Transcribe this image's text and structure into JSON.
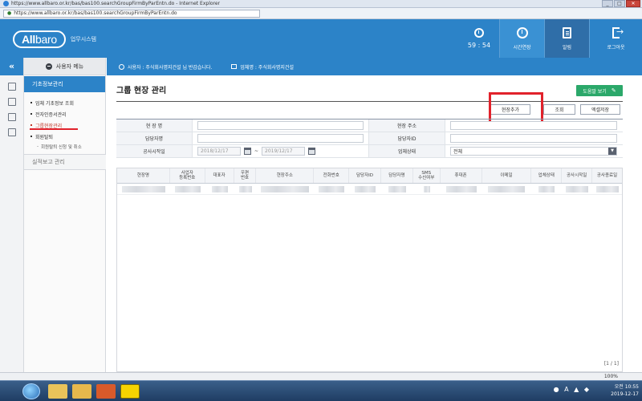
{
  "browser": {
    "title": "https://www.allbaro.or.kr/bas/bas100.searchGroupFirmByParEntn.do - Internet Explorer",
    "address": "https://www.allbaro.or.kr/bas/bas100.searchGroupFirmByParEntn.do",
    "zoom": "100%"
  },
  "header": {
    "logo_all": "All",
    "logo_baro": "baro",
    "logo_sub": "업무시스템",
    "timer": "59 : 54",
    "buttons": [
      "시간연장",
      "알림",
      "로그아웃"
    ]
  },
  "sidebar": {
    "menu_title": "사용자 메뉴",
    "active_section": "기초정보관리",
    "items": [
      "업체 기초정보 조회",
      "전자인증서관리",
      "그룹현장관리",
      "회원탈퇴"
    ],
    "sub_items": [
      "회원탈퇴 신청 및 취소"
    ],
    "other_section": "실적보고 관리"
  },
  "info_bar": {
    "user": "사용자 : 주식회사명지건설 님 반갑습니다.",
    "business": "업체명 : 주식회사명지건설"
  },
  "page": {
    "title": "그룹 현장 관리",
    "help_button": "도움말 보기",
    "actions": [
      "현장추가",
      "조회",
      "엑셀저장"
    ]
  },
  "form": {
    "site_name_label": "현 장 명",
    "site_addr_label": "현장 주소",
    "manager_name_label": "담당자명",
    "manager_id_label": "담당자ID",
    "construction_start_label": "공사시작일",
    "date_from": "2018/12/17",
    "date_to": "2019/12/17",
    "tilde": "~",
    "status_label": "업체상태",
    "status_value": "전체"
  },
  "grid": {
    "columns": [
      "현장명",
      "사업자\n등록번호",
      "대표자",
      "우편\n번호",
      "현장주소",
      "전화번호",
      "담당자ID",
      "담당자명",
      "SMS\n수신여부",
      "휴대폰",
      "이메일",
      "업체상태",
      "공사시작일",
      "공사종료일"
    ],
    "pager": "[1 / 1]"
  },
  "taskbar": {
    "time": "오전 10:55",
    "date": "2019-12-17"
  }
}
